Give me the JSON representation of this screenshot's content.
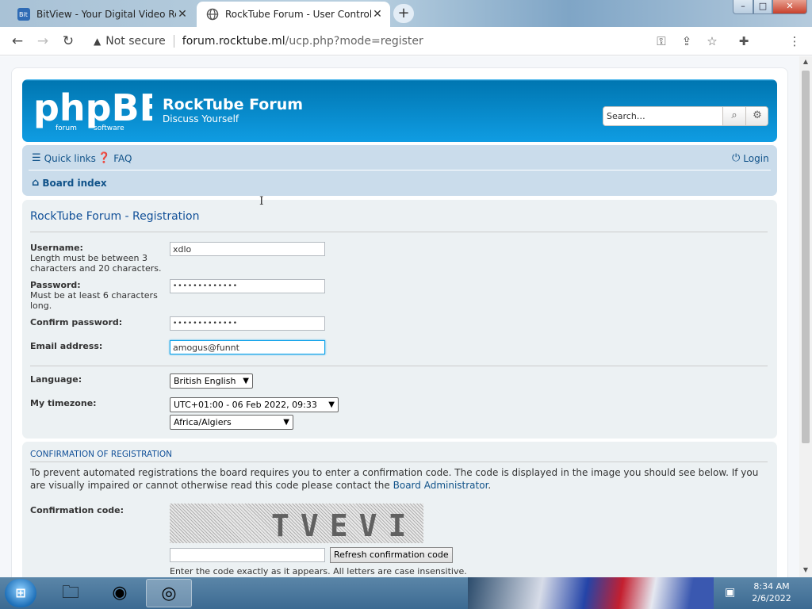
{
  "browser": {
    "tabs": [
      {
        "title": "BitView - Your Digital Video Repo"
      },
      {
        "title": "RockTube Forum - User Control P"
      }
    ],
    "security_label": "Not secure",
    "url_host": "forum.rocktube.ml",
    "url_path": "/ucp.php?mode=register"
  },
  "forum": {
    "site_title": "RockTube Forum",
    "site_desc": "Discuss Yourself",
    "search_placeholder": "Search…",
    "quick_links": "Quick links",
    "faq": "FAQ",
    "login": "Login",
    "board_index": "Board index"
  },
  "registration": {
    "title": "RockTube Forum - Registration",
    "username_label": "Username:",
    "username_explain": "Length must be between 3 characters and 20 characters.",
    "username_value": "xdlo",
    "password_label": "Password:",
    "password_explain": "Must be at least 6 characters long.",
    "password_value": "•••••••••••••",
    "confirm_label": "Confirm password:",
    "confirm_value": "•••••••••••••",
    "email_label": "Email address:",
    "email_value": "amogus@funnt",
    "language_label": "Language:",
    "language_value": "British English",
    "timezone_label": "My timezone:",
    "timezone_offset": "UTC+01:00 - 06 Feb 2022, 09:33",
    "timezone_zone": "Africa/Algiers"
  },
  "confirmation": {
    "heading": "CONFIRMATION OF REGISTRATION",
    "text_before": "To prevent automated registrations the board requires you to enter a confirmation code. The code is displayed in the image you should see below. If you are visually impaired or cannot otherwise read this code please contact the ",
    "text_link": "Board Administrator",
    "text_after": ".",
    "code_label": "Confirmation code:",
    "captcha_text": "TVEVI",
    "refresh_label": "Refresh confirmation code",
    "hint": "Enter the code exactly as it appears. All letters are case insensitive."
  },
  "taskbar": {
    "time": "8:34 AM",
    "date": "2/6/2022"
  },
  "colors": {
    "header_blue": "#12a3eb",
    "link_blue": "#105289",
    "panel_bg": "#ecf1f3"
  }
}
